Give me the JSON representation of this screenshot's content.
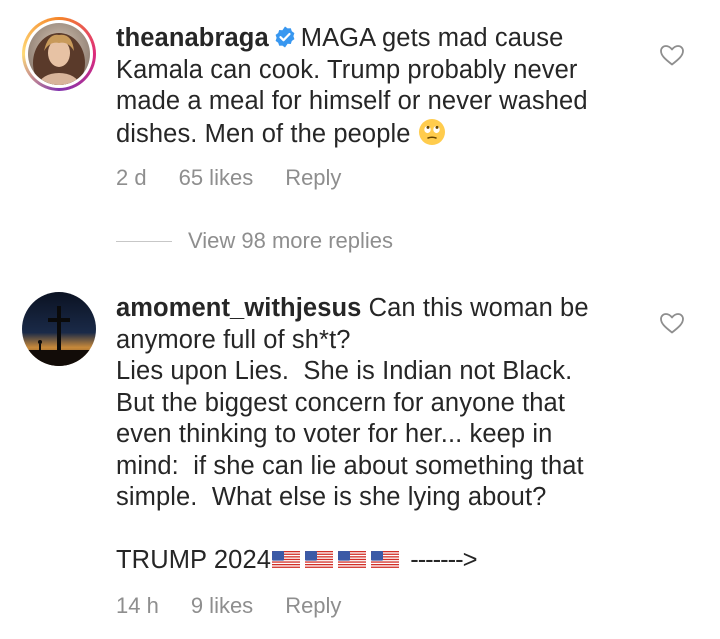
{
  "comments": [
    {
      "username": "theanabraga",
      "verified": true,
      "text": "MAGA gets mad cause Kamala can cook. Trump probably never made a meal for himself or never washed dishes. Men of the people",
      "emoji": "face-with-rolling-eyes",
      "age": "2 d",
      "likes": "65 likes",
      "reply_label": "Reply",
      "view_replies": "View 98 more replies"
    },
    {
      "username": "amoment_withjesus",
      "verified": false,
      "text_line1": "Can this woman be",
      "text_line2": "anymore full of sh*t?",
      "text_line3": "Lies upon Lies.  She is Indian not Black.",
      "text_line4": "But the biggest concern for anyone that",
      "text_line5": "even thinking to voter for her... keep in",
      "text_line6": "mind:  if she can lie about something that",
      "text_line7": "simple.  What else is she lying about?",
      "signoff": "TRUMP 2024",
      "signoff_flags": 4,
      "signoff_arrow": "------->",
      "age": "14 h",
      "likes": "9 likes",
      "reply_label": "Reply"
    }
  ],
  "icons": {
    "like": "heart-outline-icon",
    "verified": "verified-badge-icon",
    "flag": "us-flag-emoji"
  },
  "colors": {
    "text": "#262626",
    "secondary": "#8e8e8e",
    "verified_blue": "#3897f0"
  }
}
